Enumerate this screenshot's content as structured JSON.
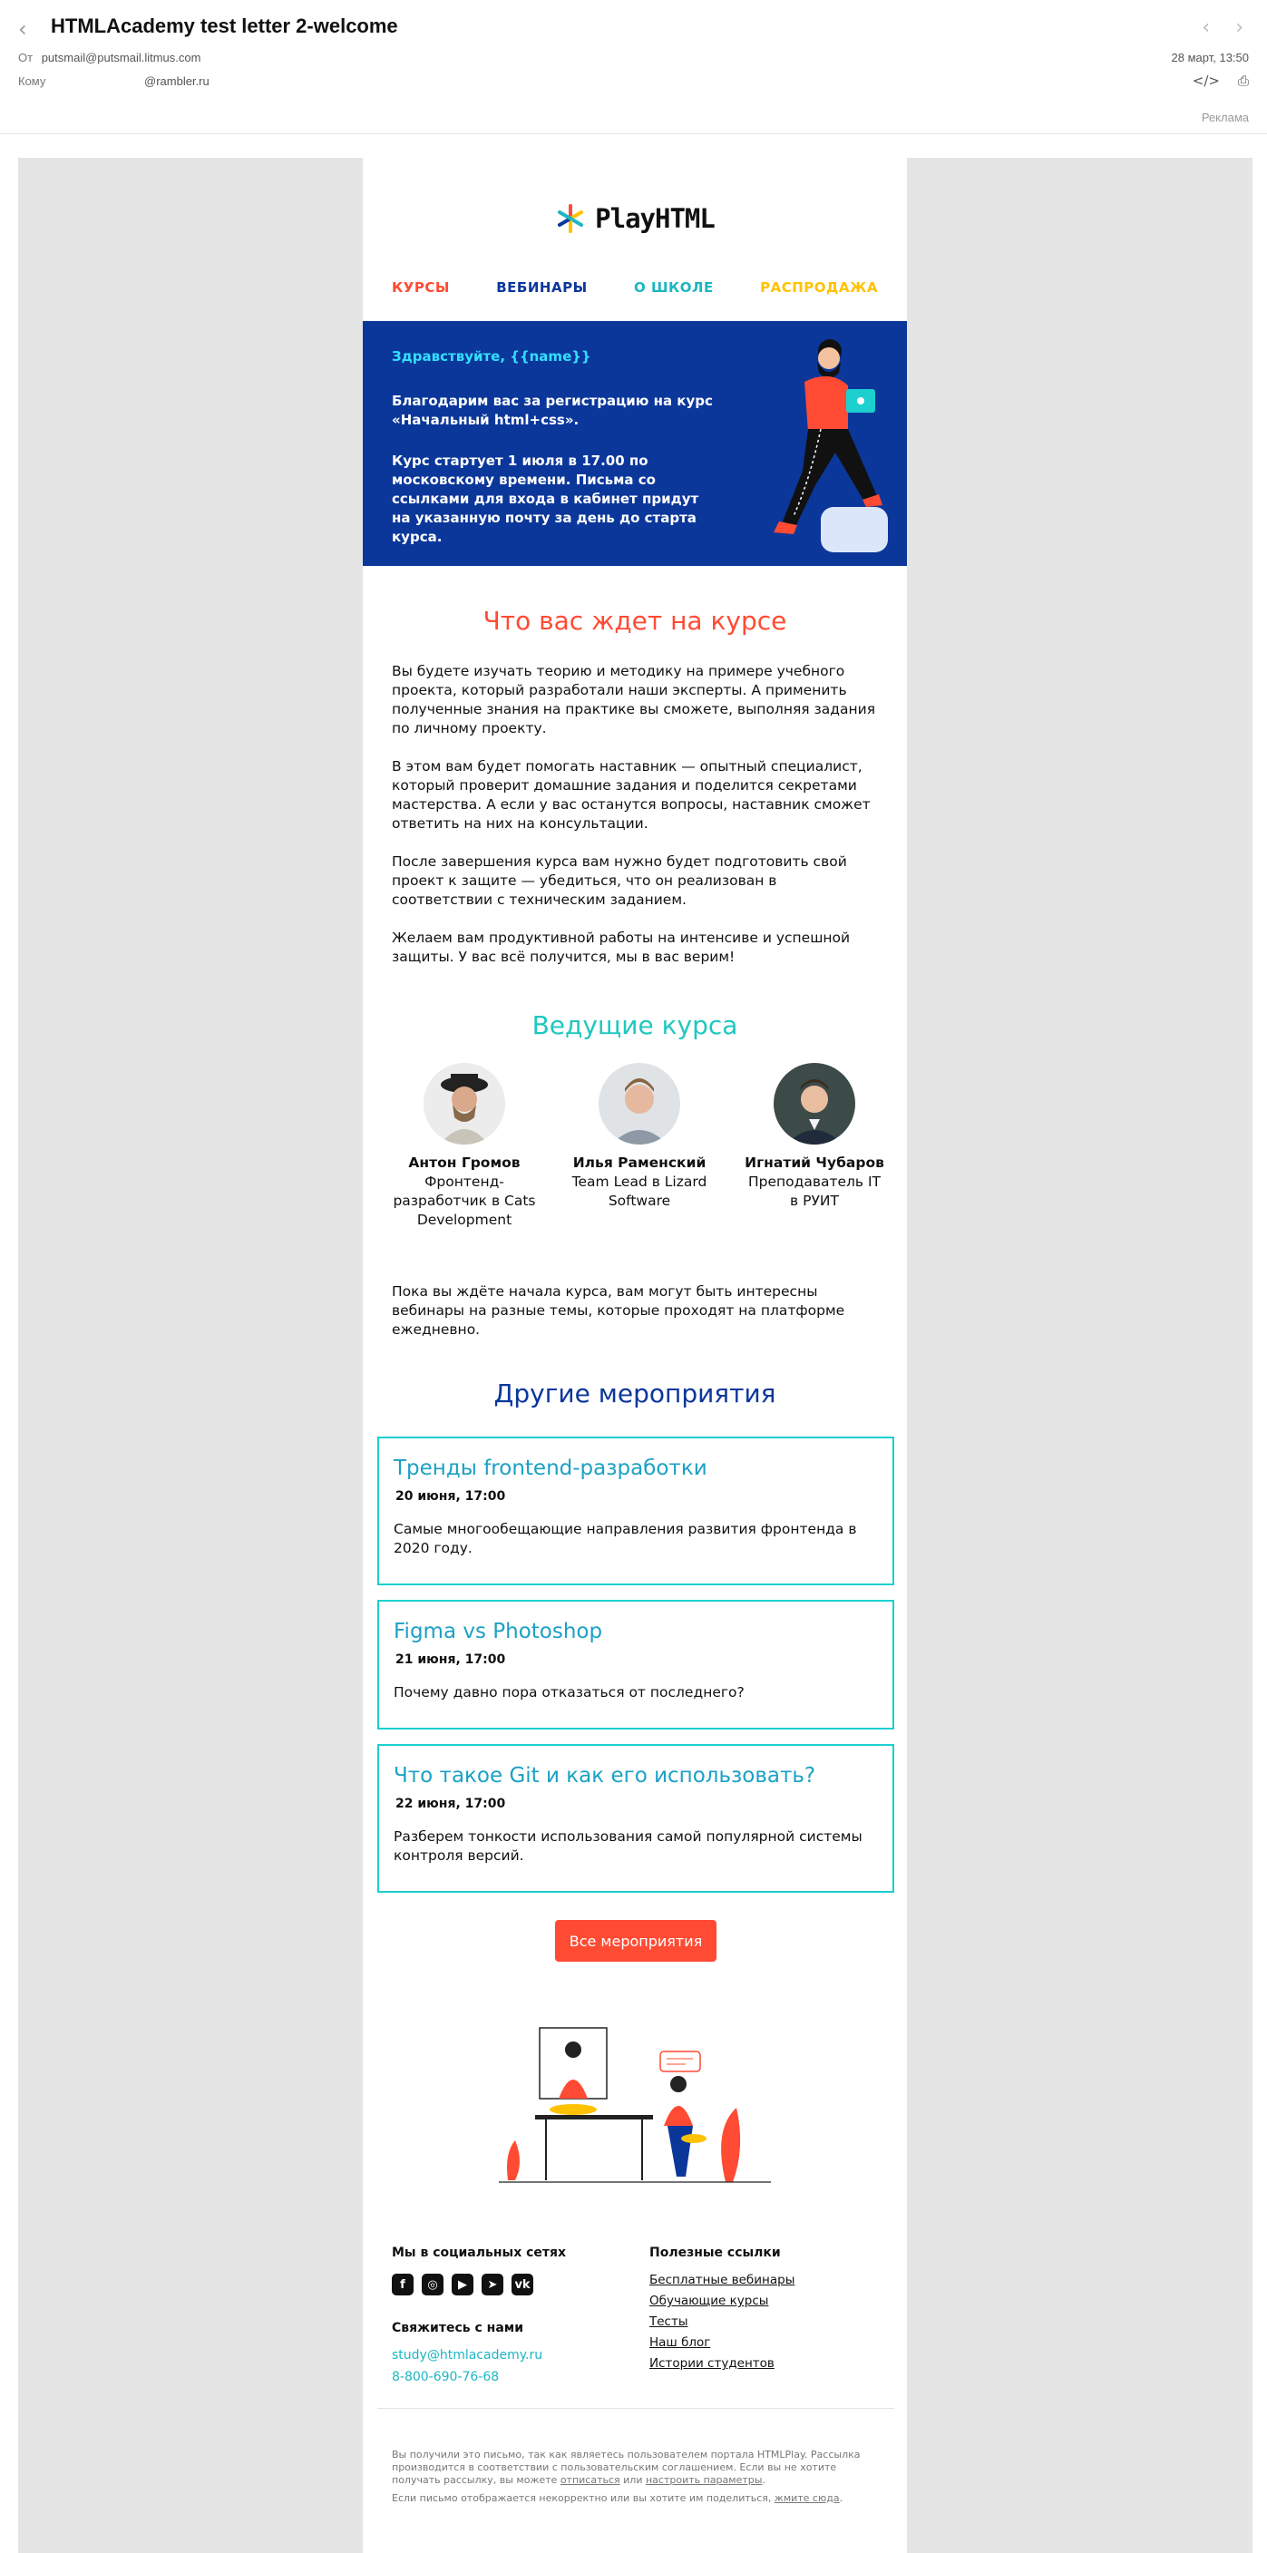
{
  "header": {
    "subject": "HTMLAcademy test letter 2-welcome",
    "from_label": "От",
    "from_value": "putsmail@putsmail.litmus.com",
    "to_label": "Кому",
    "to_value": "@rambler.ru",
    "date": "28 март, 13:50",
    "ad_label": "Реклама"
  },
  "logo": {
    "text": "PlayHTML"
  },
  "menu": [
    {
      "label": "КУРСЫ",
      "color": "#ff4b33"
    },
    {
      "label": "ВЕБИНАРЫ",
      "color": "#0b379b"
    },
    {
      "label": "О ШКОЛЕ",
      "color": "#1cb6c2"
    },
    {
      "label": "РАСПРОДАЖА",
      "color": "#ffc200"
    }
  ],
  "banner": {
    "greeting": "Здравствуйте, {{name}}",
    "text1": "Благодарим вас за регистрацию на курс «Начальный html+css».",
    "text2": "Курс стартует 1 июля в 17.00 по московскому времени. Письма со ссылками для входа в кабинет придут на указанную почту за день до старта курса."
  },
  "course": {
    "heading": "Что вас ждет на курсе",
    "paragraphs": [
      "Вы будете изучать теорию и методику на примере учебного проекта, который разработали наши эксперты. А применить полученные знания на практике вы сможете, выполняя задания по личному проекту.",
      "В этом вам будет помогать наставник — опытный специалист, который проверит домашние задания и поделится секретами мастерства. А если у вас останутся вопросы, наставник сможет ответить на них на консультации.",
      "После завершения курса вам нужно будет подготовить свой проект к защите — убедиться, что он реализован в соответствии с техническим заданием.",
      "Желаем вам продуктивной работы на интенсиве и успешной защиты. У вас всё получится, мы в вас верим!"
    ]
  },
  "teachers": {
    "heading": "Ведущие курса",
    "items": [
      {
        "name": "Антон Громов",
        "role": "Фронтенд-разработчик в Cats Development"
      },
      {
        "name": "Илья Раменский",
        "role": "Team Lead в Lizard Software"
      },
      {
        "name": "Игнатий Чубаров",
        "role": "Преподаватель IT в РУИТ"
      }
    ]
  },
  "webinars_note": "Пока вы ждёте начала курса, вам могут быть интересны вебинары на разные темы, которые проходят на платформе ежедневно.",
  "events": {
    "heading": "Другие мероприятия",
    "items": [
      {
        "title": "Тренды frontend-разработки",
        "date": "20 июня, 17:00",
        "desc": "Самые многообещающие направления развития фронтенда в 2020 году."
      },
      {
        "title": "Figma vs Photoshop",
        "date": "21 июня, 17:00",
        "desc": "Почему давно пора отказаться от последнего?"
      },
      {
        "title": "Что такое Git и как его использовать?",
        "date": "22 июня, 17:00",
        "desc": "Разберем тонкости использования самой популярной системы контроля версий."
      }
    ],
    "button": "Все мероприятия"
  },
  "footer": {
    "social_heading": "Мы в социальных сетях",
    "contact_heading": "Свяжитесь с нами",
    "email": "study@htmlacademy.ru",
    "phone": "8-800-690-76-68",
    "links_heading": "Полезные ссылки",
    "links": [
      "Бесплатные вебинары",
      "Обучающие курсы",
      "Тесты",
      "Наш блог",
      "Истории студентов"
    ],
    "fine1_a": "Вы получили это письмо, так как являетесь пользователем портала HTMLPlay. Рассылка производится в соответствии с пользовательским соглашением. Если вы не хотите получать рассылку, вы можете ",
    "fine1_link1": "отписаться",
    "fine1_b": " или ",
    "fine1_link2": "настроить параметры",
    "fine1_c": ".",
    "fine2_a": "Если письмо отображается некорректно или вы хотите им поделиться, ",
    "fine2_link": "жмите сюда",
    "fine2_b": "."
  }
}
